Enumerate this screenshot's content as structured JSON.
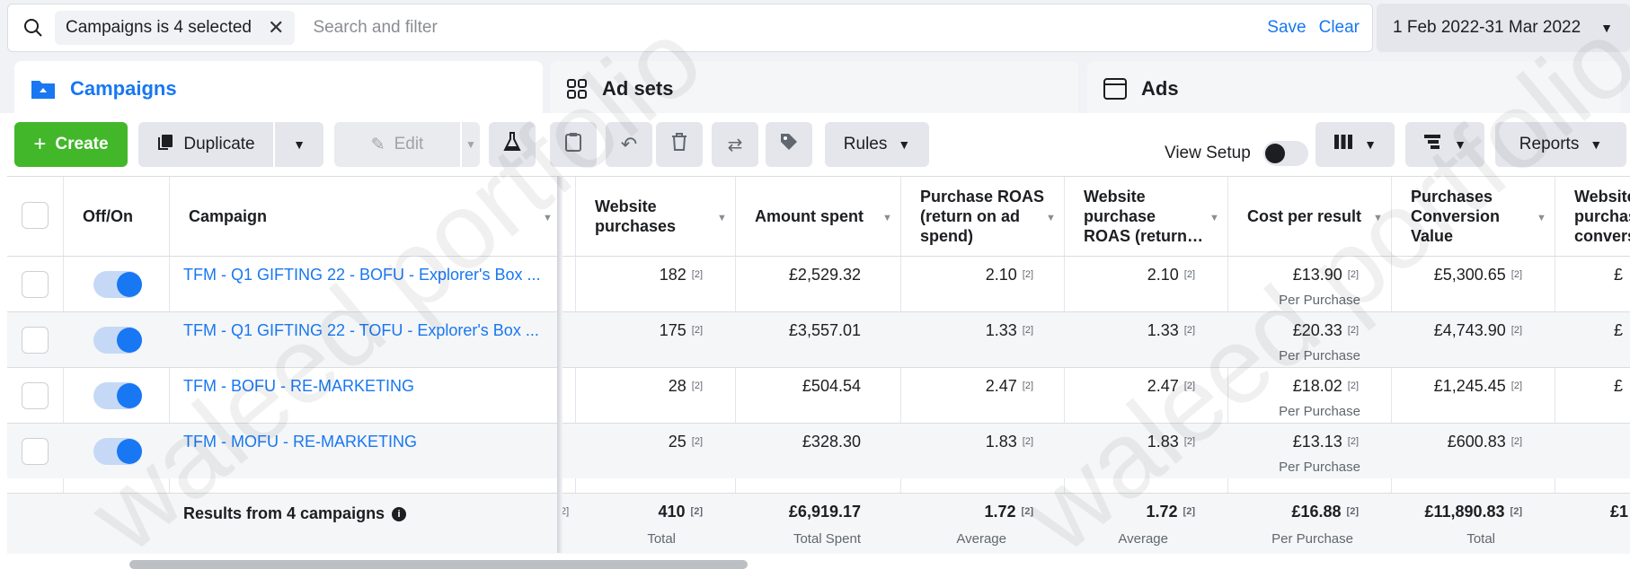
{
  "filter": {
    "chip_label": "Campaigns is 4 selected",
    "placeholder": "Search and filter",
    "save": "Save",
    "clear": "Clear"
  },
  "date_range": "1 Feb 2022-31 Mar 2022",
  "tabs": [
    {
      "label": "Campaigns",
      "icon": "campaign-folder-icon",
      "active": true
    },
    {
      "label": "Ad sets",
      "icon": "grid-icon",
      "active": false
    },
    {
      "label": "Ads",
      "icon": "ad-window-icon",
      "active": false
    }
  ],
  "toolbar": {
    "create": "Create",
    "duplicate": "Duplicate",
    "edit": "Edit",
    "rules": "Rules",
    "view_setup": "View Setup",
    "reports": "Reports"
  },
  "table": {
    "headers": {
      "onoff": "Off/On",
      "campaign": "Campaign",
      "website_purchases": "Website purchases",
      "amount_spent": "Amount spent",
      "purchase_roas": "Purchase ROAS (return on ad spend)",
      "website_purchase_roas": "Website purchase ROAS (return…",
      "cost_per_result": "Cost per result",
      "purchases_conversion_value": "Purchases Conversion Value",
      "website_purchase_conversion": "Website purchas convers"
    },
    "rows": [
      {
        "name": "TFM - Q1 GIFTING 22 - BOFU - Explorer's Box ...",
        "purchases": "182",
        "spent": "£2,529.32",
        "roas": "2.10",
        "web_roas": "2.10",
        "cpr": "£13.90",
        "cpr_sub": "Per Purchase",
        "conv_value": "£5,300.65",
        "cut": "£",
        "ref": "[2]"
      },
      {
        "name": "TFM - Q1 GIFTING 22 - TOFU - Explorer's Box ...",
        "purchases": "175",
        "spent": "£3,557.01",
        "roas": "1.33",
        "web_roas": "1.33",
        "cpr": "£20.33",
        "cpr_sub": "Per Purchase",
        "conv_value": "£4,743.90",
        "cut": "£",
        "ref": "[2]"
      },
      {
        "name": "TFM - BOFU - RE-MARKETING",
        "purchases": "28",
        "spent": "£504.54",
        "roas": "2.47",
        "web_roas": "2.47",
        "cpr": "£18.02",
        "cpr_sub": "Per Purchase",
        "conv_value": "£1,245.45",
        "cut": "£",
        "ref": "[2]"
      },
      {
        "name": "TFM - MOFU - RE-MARKETING",
        "purchases": "25",
        "spent": "£328.30",
        "roas": "1.83",
        "web_roas": "1.83",
        "cpr": "£13.13",
        "cpr_sub": "Per Purchase",
        "conv_value": "£600.83",
        "cut": "",
        "ref": "[2]"
      }
    ],
    "totals": {
      "label": "Results from 4 campaigns",
      "purchases": "410",
      "purchases_sub": "Total",
      "spent": "£6,919.17",
      "spent_sub": "Total Spent",
      "roas": "1.72",
      "roas_sub": "Average",
      "web_roas": "1.72",
      "web_roas_sub": "Average",
      "cpr": "£16.88",
      "cpr_sub": "Per Purchase",
      "conv_value": "£11,890.83",
      "conv_value_sub": "Total",
      "cut": "£1",
      "ref": "[2]",
      "edge_ref": "2]"
    }
  },
  "watermark": "waleed portfolio",
  "colors": {
    "accent": "#1877f2",
    "create": "#42b72a"
  }
}
